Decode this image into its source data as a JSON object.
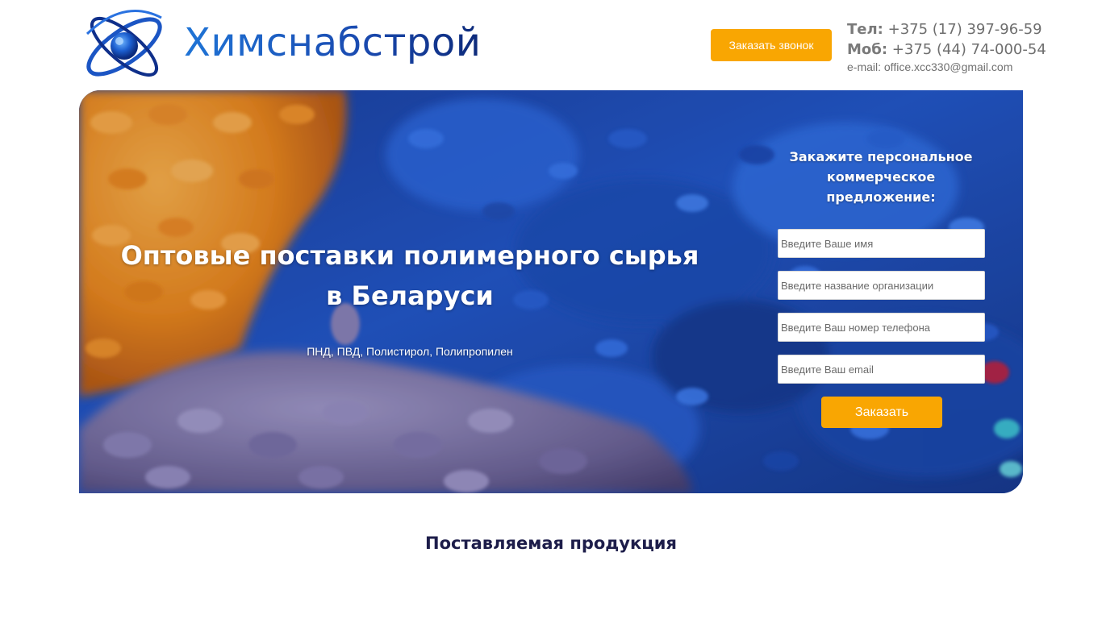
{
  "header": {
    "logo_text": "Химснабстрой",
    "callback_button": "Заказать звонок",
    "phone_label": "Тел:",
    "phone": "+375 (17) 397-96-59",
    "mobile_label": "Моб:",
    "mobile": "+375 (44) 74-000-54",
    "email": "e-mail: office.xcc330@gmail.com"
  },
  "hero": {
    "title": "Оптовые поставки полимерного сырья в Беларуси",
    "subtitle": "ПНД, ПВД, Полистирол, Полипропилен"
  },
  "order_form": {
    "title": "Закажите персональное коммерческое предложение:",
    "name_placeholder": "Введите Ваше имя",
    "organization_placeholder": "Введите название организации",
    "phone_placeholder": "Введите Ваш номер телефона",
    "email_placeholder": "Введите Ваш email",
    "submit_label": "Заказать"
  },
  "products": {
    "section_title": "Поставляемая продукция"
  },
  "colors": {
    "accent": "#f9a602",
    "brand_blue": "#1d5fc7",
    "heading_dark": "#1d1d4a"
  },
  "icons": {
    "logo": "atom-logo-icon"
  }
}
